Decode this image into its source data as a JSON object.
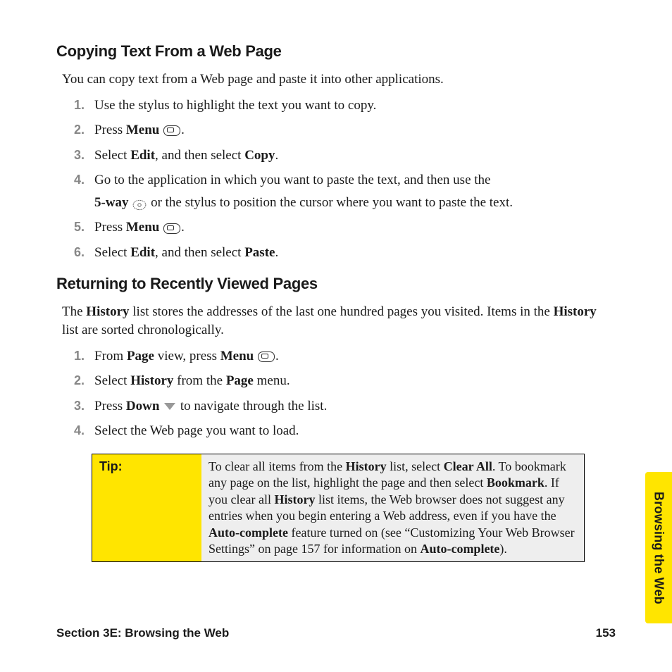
{
  "section1": {
    "heading": "Copying Text From a Web Page",
    "intro": "You can copy text from a Web page and paste it into other applications.",
    "steps": {
      "s1": "Use the stylus to highlight the text you want to copy.",
      "s2_a": "Press ",
      "s2_b": "Menu",
      "s2_c": ".",
      "s3_a": "Select ",
      "s3_b": "Edit",
      "s3_c": ", and then select ",
      "s3_d": "Copy",
      "s3_e": ".",
      "s4_a": "Go to the application in which you want to paste the text, and then use the",
      "s4_b": "5-way",
      "s4_c": " or the stylus to position the cursor where you want to paste the text.",
      "s5_a": "Press ",
      "s5_b": "Menu",
      "s5_c": ".",
      "s6_a": "Select ",
      "s6_b": "Edit",
      "s6_c": ", and then select ",
      "s6_d": "Paste",
      "s6_e": "."
    }
  },
  "section2": {
    "heading": "Returning to Recently Viewed Pages",
    "intro_a": "The ",
    "intro_b": "History",
    "intro_c": " list stores the addresses of the last one hundred pages you visited. Items in the ",
    "intro_d": "History",
    "intro_e": " list are sorted chronologically.",
    "steps": {
      "s1_a": "From ",
      "s1_b": "Page",
      "s1_c": " view, press ",
      "s1_d": "Menu",
      "s1_e": ".",
      "s2_a": "Select ",
      "s2_b": "History",
      "s2_c": " from the ",
      "s2_d": "Page",
      "s2_e": " menu.",
      "s3_a": "Press ",
      "s3_b": "Down",
      "s3_c": " to navigate through the list.",
      "s4": "Select the Web page you want to load."
    }
  },
  "tip": {
    "label": "Tip:",
    "t1": "To clear all items from the ",
    "t2": "History",
    "t3": " list, select ",
    "t4": "Clear All",
    "t5": ". To bookmark any page on the list, highlight the page and then select ",
    "t6": "Bookmark",
    "t7": ". If you clear all ",
    "t8": "History",
    "t9": " list items, the Web browser does not suggest any entries when you begin entering a Web address, even if you have the ",
    "t10": "Auto-complete",
    "t11": " feature turned on (see “Customizing Your Web Browser Settings” on page 157 for information on ",
    "t12": "Auto-complete",
    "t13": ")."
  },
  "sideTab": "Browsing the Web",
  "footer": {
    "section": "Section 3E: Browsing the Web",
    "page": "153"
  }
}
